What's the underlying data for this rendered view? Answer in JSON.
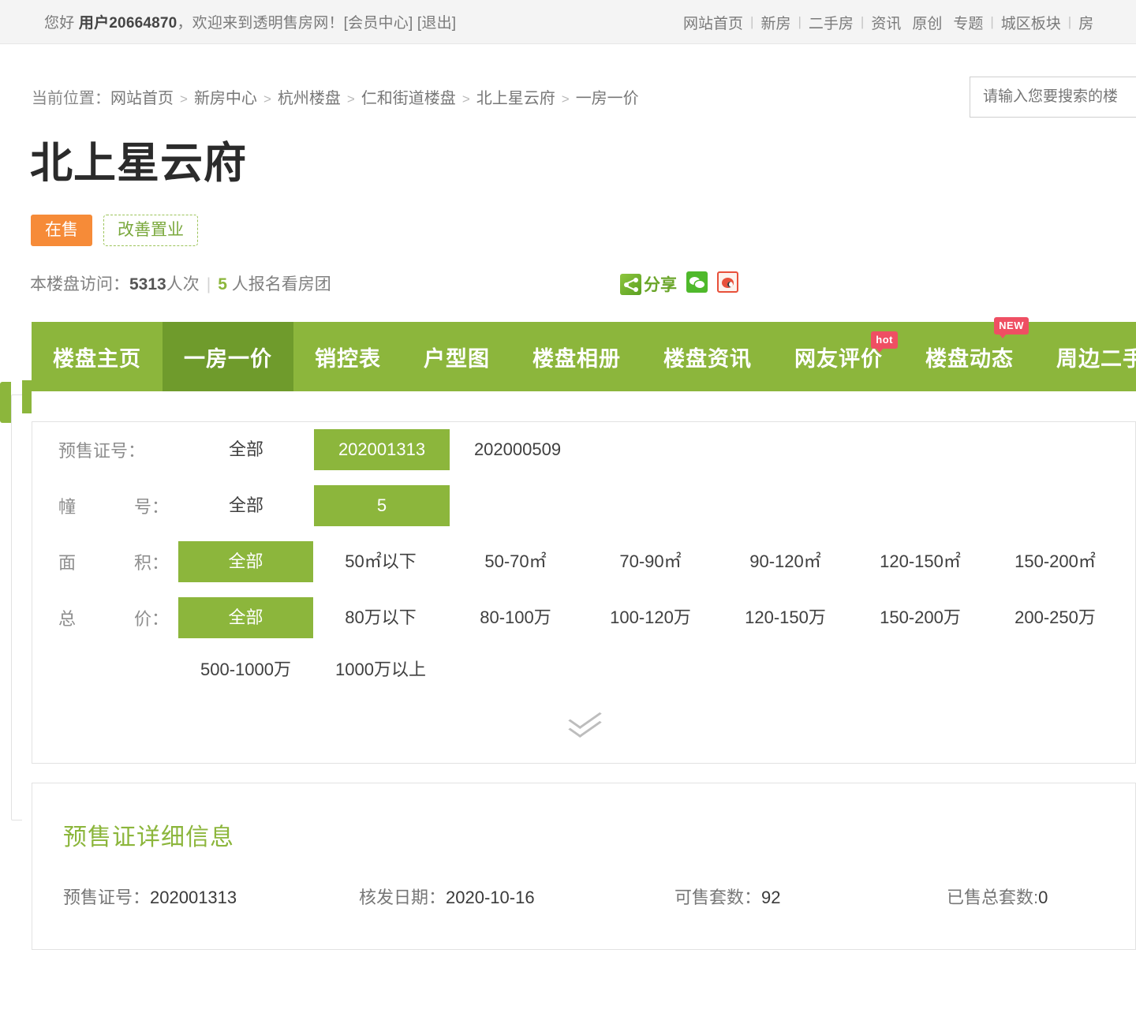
{
  "topbar": {
    "greeting": "您好",
    "username": "用户20664870",
    "welcome": "，欢迎来到透明售房网！",
    "bracket_open": "[",
    "member_center": "会员中心",
    "bracket_close": "]",
    "logout_open": "[",
    "logout": "退出",
    "logout_close": "]",
    "nav": [
      {
        "label": "网站首页",
        "sep": "|"
      },
      {
        "label": "新房",
        "sep": "|"
      },
      {
        "label": "二手房",
        "sep": "|"
      },
      {
        "label": "资讯",
        "sep": ""
      },
      {
        "label": "原创",
        "sep": ""
      },
      {
        "label": "专题",
        "sep": "|"
      },
      {
        "label": "城区板块",
        "sep": "|"
      },
      {
        "label": "房",
        "sep": ""
      }
    ]
  },
  "breadcrumb": {
    "lead": "当前位置：",
    "sep": ">",
    "items": [
      "网站首页",
      "新房中心",
      "杭州楼盘",
      "仁和街道楼盘",
      "北上星云府",
      "一房一价"
    ]
  },
  "search": {
    "placeholder": "请输入您要搜索的楼",
    "value": ""
  },
  "project": {
    "title": "北上星云府",
    "badge_sale": "在售",
    "badge_type": "改善置业",
    "visit_label": "本楼盘访问：",
    "visit_count": "5313",
    "visit_unit": "人次",
    "divider": "|",
    "signup_count": "5",
    "signup_text": "人报名看房团"
  },
  "share": {
    "share_label": "分享",
    "share_icon": "share-icon",
    "wechat_icon": "wechat-icon",
    "weibo_icon": "weibo-icon"
  },
  "tabs": [
    {
      "label": "楼盘主页",
      "active": false,
      "flag": ""
    },
    {
      "label": "一房一价",
      "active": true,
      "flag": ""
    },
    {
      "label": "销控表",
      "active": false,
      "flag": ""
    },
    {
      "label": "户型图",
      "active": false,
      "flag": ""
    },
    {
      "label": "楼盘相册",
      "active": false,
      "flag": ""
    },
    {
      "label": "楼盘资讯",
      "active": false,
      "flag": ""
    },
    {
      "label": "网友评价",
      "active": false,
      "flag": "hot"
    },
    {
      "label": "楼盘动态",
      "active": false,
      "flag": "NEW"
    },
    {
      "label": "周边二手房",
      "active": false,
      "flag": ""
    }
  ],
  "filters": {
    "cert": {
      "label": "预售证号：",
      "options": [
        {
          "text": "全部",
          "selected": false
        },
        {
          "text": "202001313",
          "selected": true
        },
        {
          "text": "202000509",
          "selected": false
        }
      ]
    },
    "building": {
      "label_left": "幢",
      "label_right": "号：",
      "options": [
        {
          "text": "全部",
          "selected": false
        },
        {
          "text": "5",
          "selected": true
        }
      ]
    },
    "area": {
      "label_left": "面",
      "label_right": "积：",
      "options": [
        {
          "text": "全部",
          "selected": true
        },
        {
          "text": "50㎡以下",
          "selected": false
        },
        {
          "text": "50-70㎡",
          "selected": false
        },
        {
          "text": "70-90㎡",
          "selected": false
        },
        {
          "text": "90-120㎡",
          "selected": false
        },
        {
          "text": "120-150㎡",
          "selected": false
        },
        {
          "text": "150-200㎡",
          "selected": false
        }
      ]
    },
    "price": {
      "label_left": "总",
      "label_right": "价：",
      "options": [
        {
          "text": "全部",
          "selected": true
        },
        {
          "text": "80万以下",
          "selected": false
        },
        {
          "text": "80-100万",
          "selected": false
        },
        {
          "text": "100-120万",
          "selected": false
        },
        {
          "text": "120-150万",
          "selected": false
        },
        {
          "text": "150-200万",
          "selected": false
        },
        {
          "text": "200-250万",
          "selected": false
        }
      ],
      "extra_options": [
        {
          "text": "500-1000万",
          "selected": false
        },
        {
          "text": "1000万以上",
          "selected": false
        }
      ]
    },
    "expand_icon": "chevron-double-down-icon"
  },
  "detail": {
    "title": "预售证详细信息",
    "cert_label": "预售证号：",
    "cert_value": "202001313",
    "issue_label": "核发日期：",
    "issue_value": "2020-10-16",
    "available_label": "可售套数：",
    "available_value": "92",
    "sold_label": "已售总套数:",
    "sold_value": "0"
  },
  "colors": {
    "green": "#8cb63c",
    "green_dark": "#6f9b2c",
    "orange": "#f68b38",
    "flag_red": "#ef4f63"
  }
}
